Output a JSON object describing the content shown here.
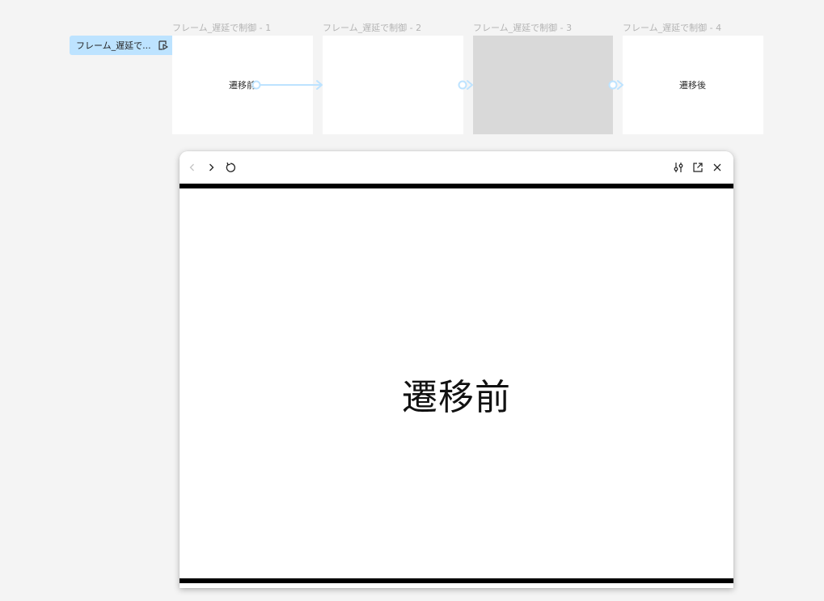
{
  "frames": [
    {
      "label": "フレーム_遅延で制御 - 1",
      "content": "遷移前"
    },
    {
      "label": "フレーム_遅延で制御 - 2",
      "content": ""
    },
    {
      "label": "フレーム_遅延で制御 - 3",
      "content": ""
    },
    {
      "label": "フレーム_遅延で制御 - 4",
      "content": "遷移後"
    }
  ],
  "flow": {
    "label": "フレーム_遅延で..."
  },
  "colors": {
    "connector": "#bde3ff",
    "frame3": "#d9d9d9",
    "canvas": "#f4f4f4"
  },
  "preview": {
    "toolbar": {
      "back_icon": "chevron-left",
      "forward_icon": "chevron-right",
      "restart_icon": "restart",
      "settings_icon": "sliders",
      "open_icon": "external-link",
      "close_icon": "close"
    },
    "content_text": "遷移前"
  }
}
